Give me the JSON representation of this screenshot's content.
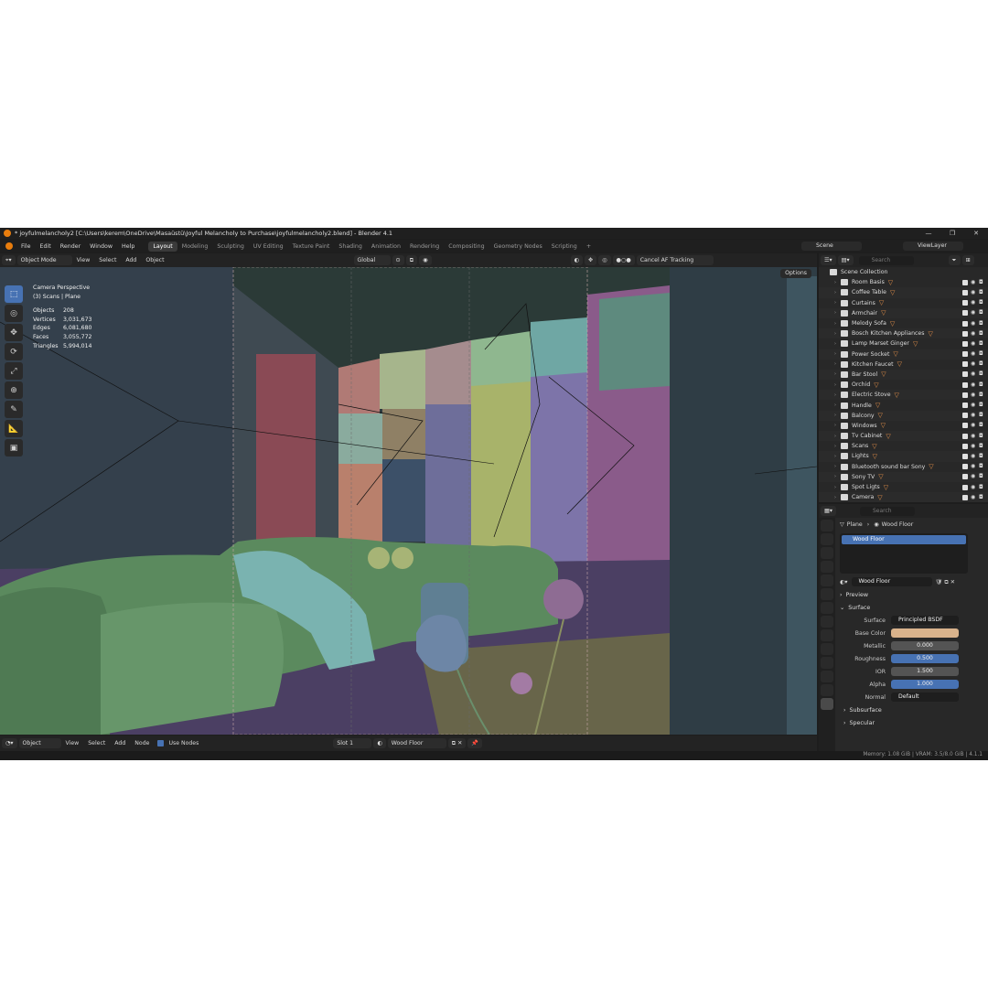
{
  "window": {
    "title": "* joyfulmelancholy2 [C:\\Users\\kerem\\OneDrive\\Masaüstü\\Joyful Melancholy to Purchase\\joyfulmelancholy2.blend] - Blender 4.1",
    "controls": [
      "—",
      "❐",
      "✕"
    ]
  },
  "menu": {
    "items": [
      "File",
      "Edit",
      "Render",
      "Window",
      "Help"
    ],
    "workspaces": [
      "Layout",
      "Modeling",
      "Sculpting",
      "UV Editing",
      "Texture Paint",
      "Shading",
      "Animation",
      "Rendering",
      "Compositing",
      "Geometry Nodes",
      "Scripting"
    ],
    "add_tab": "+",
    "scene": "Scene",
    "view_layer": "ViewLayer"
  },
  "viewport_header": {
    "mode": "Object Mode",
    "menus": [
      "View",
      "Select",
      "Add",
      "Object"
    ],
    "orientation": "Global",
    "af_button": "Cancel AF Tracking",
    "options": "Options"
  },
  "viewport": {
    "camera_label": "Camera Perspective",
    "collection_label": "(3) Scans | Plane",
    "stats": [
      {
        "k": "Objects",
        "v": "208"
      },
      {
        "k": "Vertices",
        "v": "3,031,673"
      },
      {
        "k": "Edges",
        "v": "6,081,680"
      },
      {
        "k": "Faces",
        "v": "3,055,772"
      },
      {
        "k": "Triangles",
        "v": "5,994,014"
      }
    ]
  },
  "outliner": {
    "search_placeholder": "Search",
    "root": "Scene Collection",
    "items": [
      "Room Basis",
      "Coffee Table",
      "Curtains",
      "Armchair",
      "Melody Sofa",
      "Bosch Kitchen Appliances",
      "Lamp Marset Ginger",
      "Power Socket",
      "Kitchen Faucet",
      "Bar Stool",
      "Orchid",
      "Electric Stove",
      "Handle",
      "Balcony",
      "Windows",
      "Tv Cabinet",
      "Scans",
      "Lights",
      "Bluetooth sound bar Sony",
      "Sony TV",
      "Spot Ligts",
      "Camera"
    ]
  },
  "properties": {
    "search_placeholder": "Search",
    "breadcrumb_object": "Plane",
    "breadcrumb_material": "Wood Floor",
    "slot_selected": "Wood Floor",
    "material_name": "Wood Floor",
    "panels": {
      "preview": "Preview",
      "surface": "Surface",
      "subsurface": "Subsurface",
      "specular": "Specular"
    },
    "surface_shader": "Principled BSDF",
    "fields": [
      {
        "label": "Surface",
        "value": "Principled BSDF"
      },
      {
        "label": "Base Color",
        "value": ""
      },
      {
        "label": "Metallic",
        "value": "0.000"
      },
      {
        "label": "Roughness",
        "value": "0.500"
      },
      {
        "label": "IOR",
        "value": "1.500"
      },
      {
        "label": "Alpha",
        "value": "1.000"
      },
      {
        "label": "Normal",
        "value": "Default"
      }
    ],
    "base_color": "#d9b38c"
  },
  "node_header": {
    "type": "Object",
    "menus": [
      "View",
      "Select",
      "Add",
      "Node"
    ],
    "use_nodes": "Use Nodes",
    "slot": "Slot 1",
    "material": "Wood Floor"
  },
  "status": {
    "text": "Memory: 1.08 GiB | VRAM: 3.5/8.0 GiB | 4.1.1"
  },
  "colors": {
    "accent": "#4772b3",
    "blender_orange": "#e87d0d",
    "sofa_green": "#5b8a5e",
    "object_orange": "#e8924a"
  }
}
